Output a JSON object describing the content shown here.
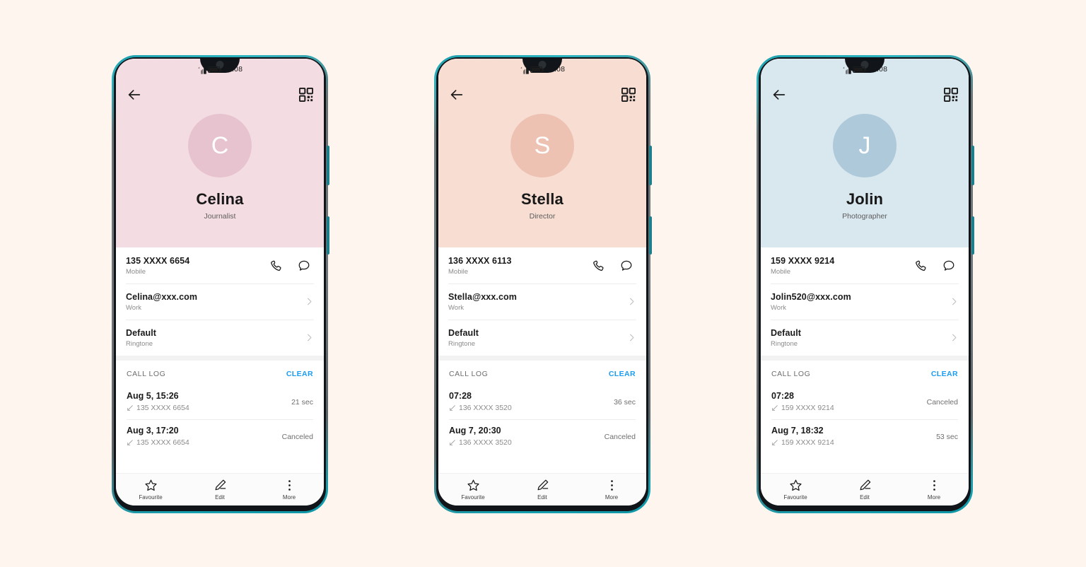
{
  "canvas": {
    "background": "#FEF6EE"
  },
  "device": {
    "frame_color": "#6f7679",
    "accent_edge_color": "#17a2b2",
    "bezel_color": "#111418"
  },
  "status_bar": {
    "time": "08:08",
    "signal_icon": "signal-bars-icon",
    "battery_icon": "battery-full-icon"
  },
  "common": {
    "back_icon": "back-arrow-icon",
    "qr_icon": "qr-code-icon",
    "call_icon": "phone-call-icon",
    "message_icon": "message-bubble-icon",
    "chevron_icon": "chevron-right-icon",
    "missed_call_icon": "missed-call-arrow-icon",
    "call_log_header": "CALL LOG",
    "clear_label": "CLEAR",
    "nav": [
      {
        "label": "Favourite",
        "icon": "star-icon"
      },
      {
        "label": "Edit",
        "icon": "pencil-icon"
      },
      {
        "label": "More",
        "icon": "more-vertical-icon"
      }
    ]
  },
  "phones": [
    {
      "id": "phone-celina",
      "theme": {
        "hero_background": "#f4dce3",
        "avatar_background": "#e6c3ce",
        "initial_color": "#ffffff"
      },
      "contact": {
        "initial": "C",
        "name": "Celina",
        "job_title": "Journalist"
      },
      "info_rows": [
        {
          "primary": "135 XXXX 6654",
          "secondary": "Mobile",
          "trailing": "actions"
        },
        {
          "primary": "Celina@xxx.com",
          "secondary": "Work",
          "trailing": "chevron"
        },
        {
          "primary": "Default",
          "secondary": "Ringtone",
          "trailing": "chevron"
        }
      ],
      "call_log": [
        {
          "when": "Aug 5, 15:26",
          "number": "135 XXXX 6654",
          "duration": "21 sec"
        },
        {
          "when": "Aug 3, 17:20",
          "number": "135 XXXX 6654",
          "duration": "Canceled"
        }
      ]
    },
    {
      "id": "phone-stella",
      "theme": {
        "hero_background": "#f7ddd2",
        "avatar_background": "#eec2b2",
        "initial_color": "#ffffff"
      },
      "contact": {
        "initial": "S",
        "name": "Stella",
        "job_title": "Director"
      },
      "info_rows": [
        {
          "primary": "136 XXXX 6113",
          "secondary": "Mobile",
          "trailing": "actions"
        },
        {
          "primary": "Stella@xxx.com",
          "secondary": "Work",
          "trailing": "chevron"
        },
        {
          "primary": "Default",
          "secondary": "Ringtone",
          "trailing": "chevron"
        }
      ],
      "call_log": [
        {
          "when": "07:28",
          "number": "136 XXXX 3520",
          "duration": "36 sec"
        },
        {
          "when": "Aug 7, 20:30",
          "number": "136 XXXX 3520",
          "duration": "Canceled"
        }
      ]
    },
    {
      "id": "phone-jolin",
      "theme": {
        "hero_background": "#d9e7ef",
        "avatar_background": "#adc9da",
        "initial_color": "#ffffff"
      },
      "contact": {
        "initial": "J",
        "name": "Jolin",
        "job_title": "Photographer"
      },
      "info_rows": [
        {
          "primary": "159 XXXX 9214",
          "secondary": "Mobile",
          "trailing": "actions"
        },
        {
          "primary": "Jolin520@xxx.com",
          "secondary": "Work",
          "trailing": "chevron"
        },
        {
          "primary": "Default",
          "secondary": "Ringtone",
          "trailing": "chevron"
        }
      ],
      "call_log": [
        {
          "when": "07:28",
          "number": "159 XXXX 9214",
          "duration": "Canceled"
        },
        {
          "when": "Aug 7, 18:32",
          "number": "159 XXXX 9214",
          "duration": "53 sec"
        }
      ]
    }
  ]
}
